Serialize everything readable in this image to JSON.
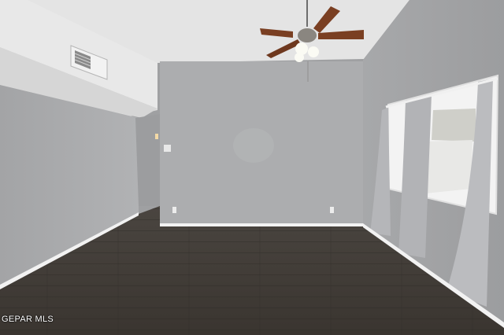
{
  "scene": {
    "description_tag": "empty-room-interior",
    "colors": {
      "wall": "#a8a9ab",
      "ceiling": "#e6e6e6",
      "floor": "#3f3a35",
      "trim": "#f2f2f2",
      "curtain": "#b9babd",
      "window_light": "#f4f4f4",
      "fan_blade": "#7a3f22"
    }
  },
  "watermark": {
    "text": "GEPAR MLS"
  }
}
